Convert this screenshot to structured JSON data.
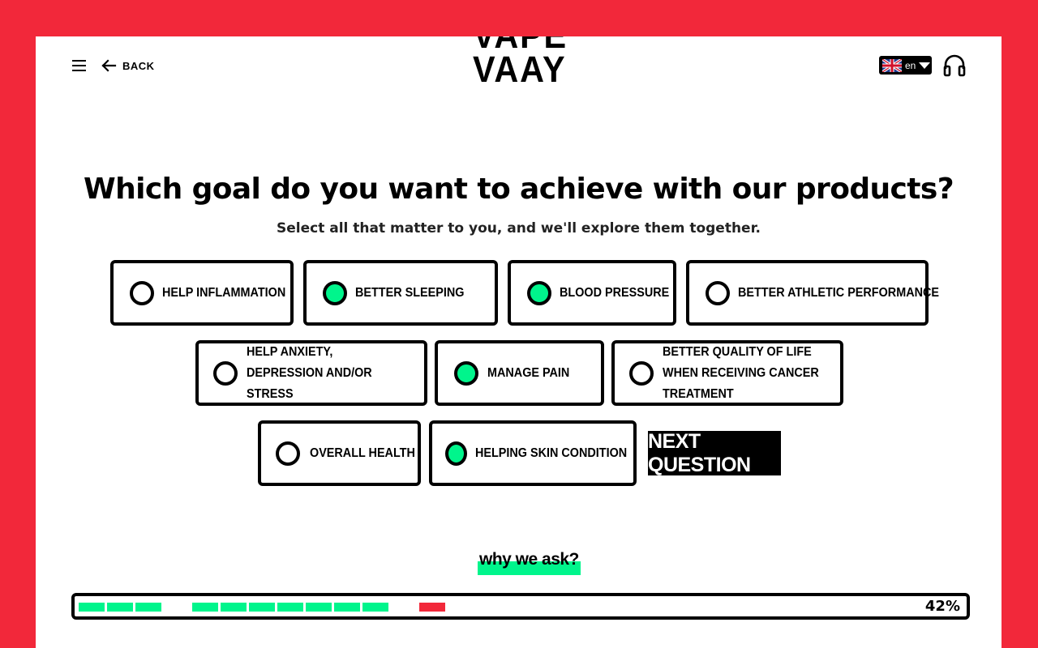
{
  "header": {
    "menu_icon": "hamburger-menu-icon",
    "back_label": "BACK",
    "logo_line1": "VAPE",
    "logo_line2": "VAAY",
    "language": "en",
    "support_icon": "headphones-icon"
  },
  "question": {
    "title": "Which goal do you want to achieve with our products?",
    "subtitle": "Select all that matter to you,  and we'll explore them together."
  },
  "options": [
    {
      "label": "HELP INFLAMMATION",
      "selected": false
    },
    {
      "label": "BETTER SLEEPING",
      "selected": true
    },
    {
      "label": "BLOOD PRESSURE",
      "selected": true
    },
    {
      "label": "BETTER ATHLETIC PERFORMANCE",
      "selected": false
    },
    {
      "label": "HELP ANXIETY, DEPRESSION AND/OR STRESS",
      "selected": false
    },
    {
      "label": "MANAGE PAIN",
      "selected": true
    },
    {
      "label": "BETTER QUALITY OF LIFE WHEN RECEIVING CANCER TREATMENT",
      "selected": false
    },
    {
      "label": "OVERALL HEALTH",
      "selected": false
    },
    {
      "label": "HELPING SKIN CONDITION",
      "selected": true
    }
  ],
  "next_button": "NEXT QUESTION",
  "why_link": "why we ask?",
  "progress": {
    "percent_label": "42%",
    "percent": 42,
    "segments": [
      "done",
      "done",
      "done",
      "gap",
      "done",
      "done",
      "done",
      "done",
      "done",
      "done",
      "done",
      "gap",
      "current"
    ]
  },
  "colors": {
    "accent": "#00f58c",
    "brand_red": "#f2283a",
    "dark": "#000000"
  }
}
